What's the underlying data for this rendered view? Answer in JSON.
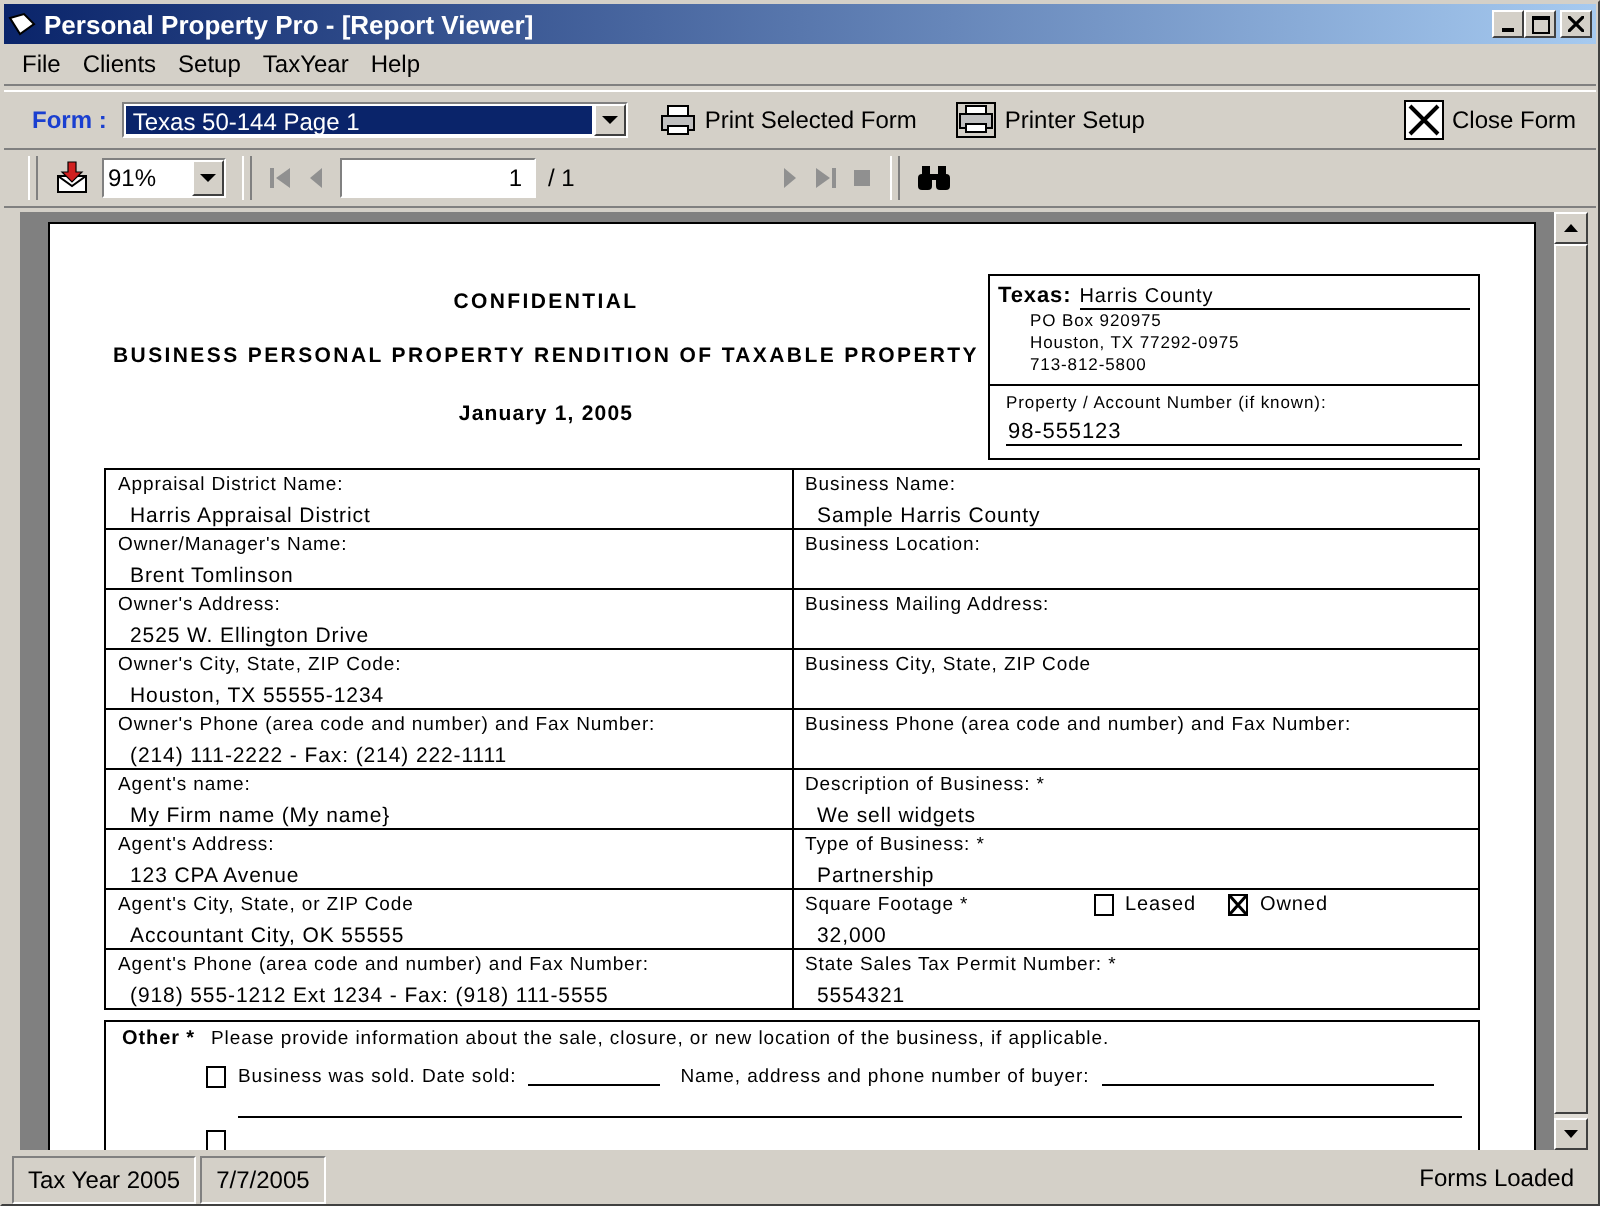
{
  "window": {
    "title": "Personal Property Pro - [Report Viewer]"
  },
  "menu": [
    "File",
    "Clients",
    "Setup",
    "TaxYear",
    "Help"
  ],
  "form_toolbar": {
    "label": "Form :",
    "form_select": "Texas 50-144 Page 1",
    "buttons": [
      {
        "kind": "print",
        "label": "Print Selected Form"
      },
      {
        "kind": "printer",
        "label": "Printer Setup"
      },
      {
        "kind": "close",
        "label": "Close Form"
      }
    ]
  },
  "viewer_toolbar": {
    "zoom": "91%",
    "page": "1",
    "page_total": "/ 1"
  },
  "report": {
    "headings": [
      "CONFIDENTIAL",
      "BUSINESS PERSONAL PROPERTY RENDITION OF TAXABLE PROPERTY",
      "January 1, 2005"
    ],
    "district": {
      "state": "Texas:",
      "county": "Harris County",
      "address": [
        "PO Box 920975",
        "Houston, TX  77292-0975",
        "713-812-5800"
      ],
      "account_label": "Property / Account Number (if known):",
      "account_number": "98-555123"
    },
    "rows": [
      {
        "left": {
          "label": "Appraisal District Name:",
          "value": "Harris Appraisal District"
        },
        "right": {
          "label": "Business Name:",
          "value": "Sample Harris County"
        }
      },
      {
        "left": {
          "label": "Owner/Manager's Name:",
          "value": "Brent Tomlinson"
        },
        "right": {
          "label": "Business Location:"
        }
      },
      {
        "left": {
          "label": "Owner's Address:",
          "value": "2525 W. Ellington Drive"
        },
        "right": {
          "label": "Business Mailing Address:"
        }
      },
      {
        "left": {
          "label": "Owner's City, State, ZIP Code:",
          "value": "Houston, TX  55555-1234"
        },
        "right": {
          "label": "Business City, State, ZIP Code"
        }
      },
      {
        "left": {
          "label": "Owner's Phone (area code and number) and Fax Number:",
          "value": "(214) 111-2222  -  Fax: (214) 222-1111"
        },
        "right": {
          "label": "Business Phone (area code and number) and Fax Number:"
        }
      },
      {
        "left": {
          "label": "Agent's name:",
          "value": "My Firm name (My name}"
        },
        "right": {
          "label": "Description of Business: *",
          "value": "We sell widgets"
        }
      },
      {
        "left": {
          "label": "Agent's Address:",
          "value": "123 CPA Avenue"
        },
        "right": {
          "label": "Type of Business: *",
          "value": "Partnership"
        }
      },
      {
        "left": {
          "label": "Agent's City, State, or ZIP Code",
          "value": "Accountant City, OK  55555"
        },
        "right": {
          "label": "Square Footage *",
          "value": "32,000",
          "options": [
            {
              "label": "Leased",
              "checked": false
            },
            {
              "label": "Owned",
              "checked": true
            }
          ]
        }
      },
      {
        "left": {
          "label": "Agent's Phone (area code and number) and Fax Number:",
          "value": "(918) 555-1212 Ext 1234  -  Fax: (918) 111-5555"
        },
        "right": {
          "label": "State Sales Tax Permit Number: *",
          "value": "5554321"
        }
      }
    ],
    "other": {
      "label": "Other *",
      "note": "Please provide information about the sale, closure, or new location of the business, if applicable.",
      "sold": {
        "checked": false,
        "label": "Business was sold.  Date sold:",
        "buyer_label": "Name, address and phone number of buyer:"
      },
      "closed": {
        "checked": false
      }
    }
  },
  "status_bar": [
    "Tax Year 2005",
    "7/7/2005",
    "Forms Loaded"
  ]
}
